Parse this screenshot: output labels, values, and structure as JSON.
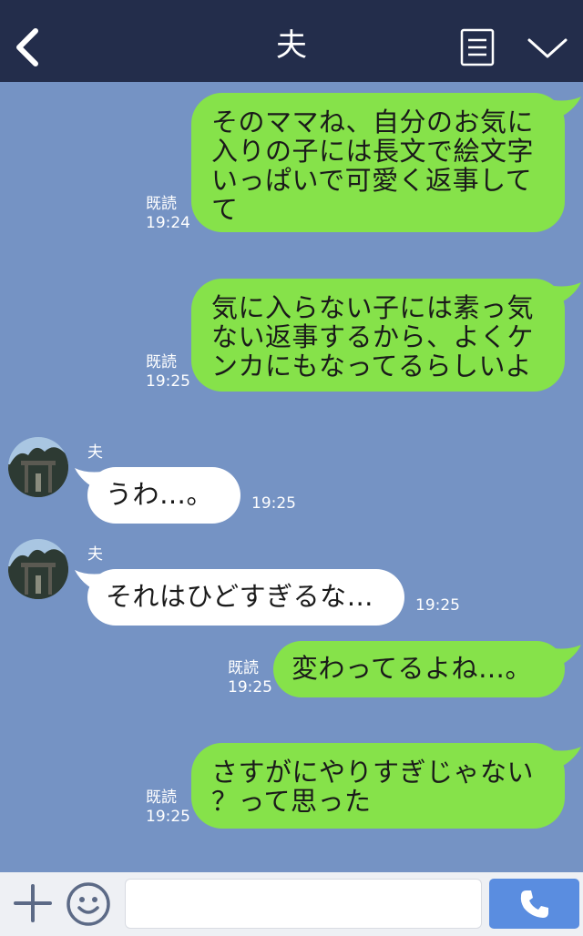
{
  "header": {
    "title": "夫",
    "back_icon": "chevron-left-icon",
    "menu_icon": "list-menu-icon",
    "expand_icon": "chevron-down-icon"
  },
  "messages": [
    {
      "from": "me",
      "text": "そのママね、自分のお気に入りの子には長文で絵文字いっぱいで可愛く返事してて",
      "lines": [
        "そのママね、自分のお気に",
        "入りの子には長文で絵文字",
        "いっぱいで可愛く返事して",
        "て"
      ],
      "read": "既読",
      "time": "19:24"
    },
    {
      "from": "me",
      "text": "気に入らない子には素っ気ない返事するから、よくケンカにもなってるらしいよ",
      "lines": [
        "気に入らない子には素っ気",
        "ない返事するから、よくケ",
        "ンカにもなってるらしいよ"
      ],
      "read": "既読",
      "time": "19:25"
    },
    {
      "from": "them",
      "sender": "夫",
      "text": "うわ…。",
      "time": "19:25"
    },
    {
      "from": "them",
      "sender": "夫",
      "text": "それはひどすぎるな…",
      "time": "19:25"
    },
    {
      "from": "me",
      "text": "変わってるよね…。",
      "read": "既読",
      "time": "19:25"
    },
    {
      "from": "me",
      "text": "さすがにやりすぎじゃない？って思った",
      "lines": [
        "さすがにやりすぎじゃない",
        "？って思った"
      ],
      "read": "既読",
      "time": "19:25"
    }
  ],
  "footer": {
    "add_icon": "plus-icon",
    "emoji_icon": "smiley-icon",
    "input_value": "",
    "call_icon": "phone-icon"
  },
  "colors": {
    "header_bg": "#232d4b",
    "chat_bg": "#7593c4",
    "my_bubble": "#86e24a",
    "their_bubble": "#ffffff",
    "call_button": "#5a8de0"
  }
}
